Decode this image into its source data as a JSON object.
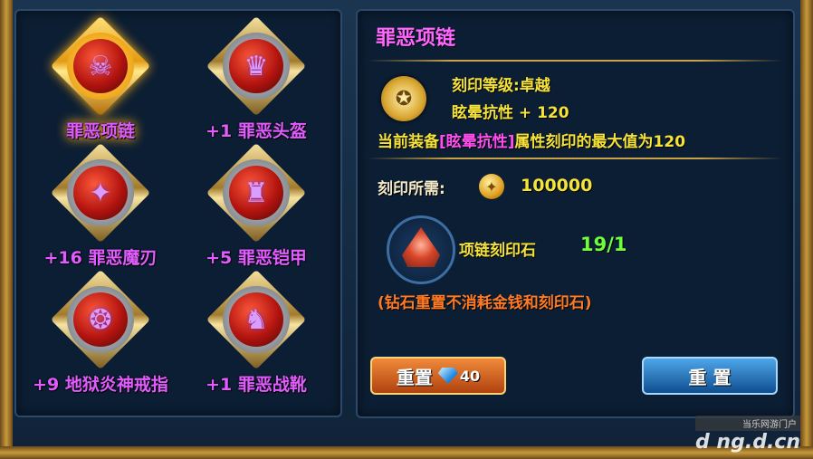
{
  "equipment": [
    {
      "label": "罪恶项链",
      "icon": "necklace-icon",
      "glyph": "☠"
    },
    {
      "label": "+1 罪恶头盔",
      "icon": "helmet-icon",
      "glyph": "♛"
    },
    {
      "label": "+16 罪恶魔刃",
      "icon": "blade-icon",
      "glyph": "✦"
    },
    {
      "label": "+5 罪恶铠甲",
      "icon": "armor-icon",
      "glyph": "♜"
    },
    {
      "label": "+9 地狱炎神戒指",
      "icon": "ring-icon",
      "glyph": "❂"
    },
    {
      "label": "+1 罪恶战靴",
      "icon": "boots-icon",
      "glyph": "♞"
    }
  ],
  "detail": {
    "title": "罪恶项链",
    "engrave_level": "刻印等级:卓越",
    "stat_line": "眩晕抗性 + 120",
    "max_line_prefix": "当前装备",
    "max_line_highlight": "[眩晕抗性]",
    "max_line_suffix": "属性刻印的最大值为120",
    "cost_label": "刻印所需:",
    "cost_value": "100000",
    "material_name": "项链刻印石",
    "material_count": "19/1",
    "note": "(钻石重置不消耗金钱和刻印石)"
  },
  "buttons": {
    "gem_reset_label": "重置",
    "gem_cost": "40",
    "reset_label": "重 置"
  },
  "watermark": {
    "small": "当乐网游门户",
    "big": "d ng.d.cn"
  },
  "colors": {
    "title": "#ff66ff",
    "item_label": "#e05cff",
    "stat_text": "#f5e23a",
    "count": "#6dff3a",
    "note": "#ff7a24"
  }
}
